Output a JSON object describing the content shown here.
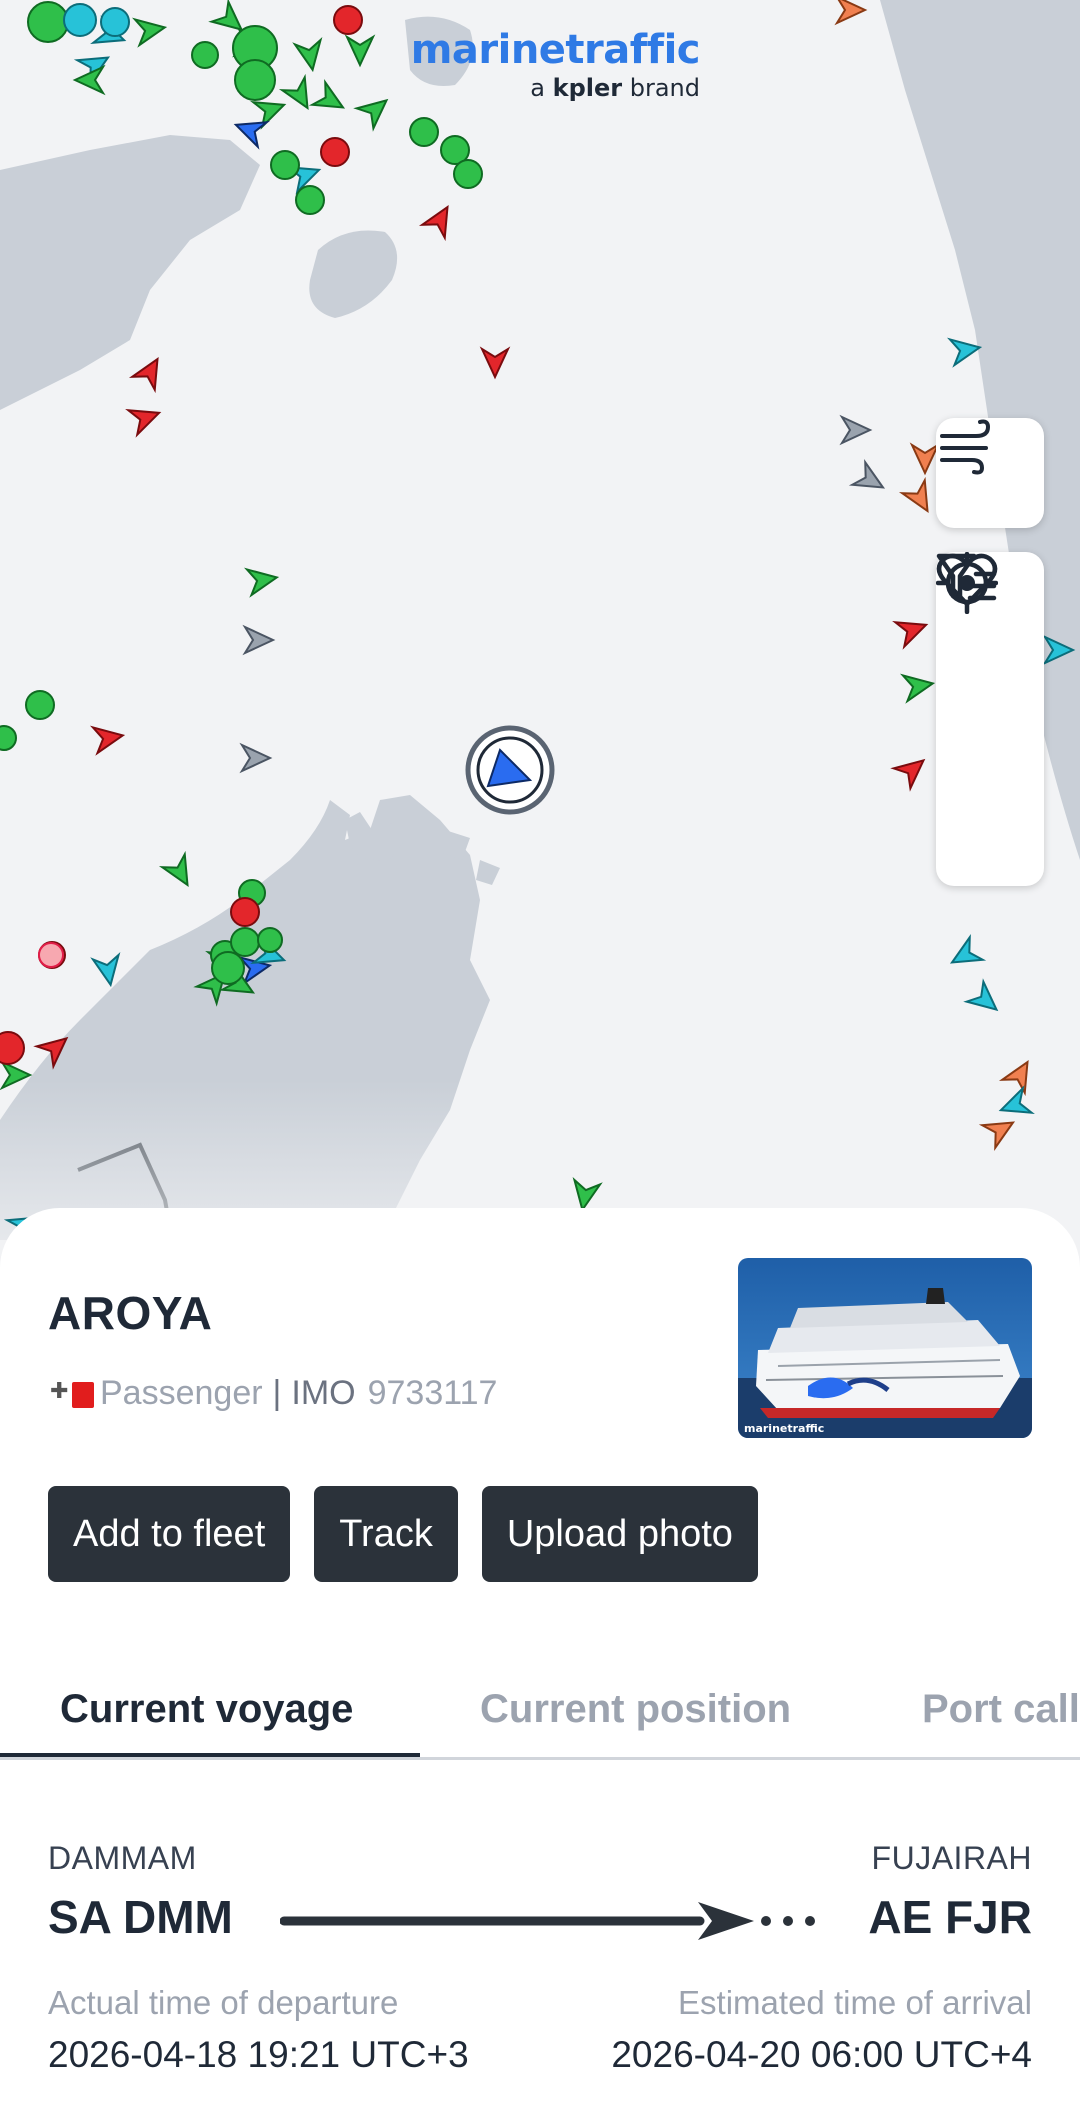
{
  "brand": {
    "name": "marinetraffic",
    "sub_prefix": "a",
    "sub_bold": "kpler",
    "sub_suffix": "brand"
  },
  "map_controls": {
    "wind_icon": "wind-icon",
    "favorite_icon": "heart-icon",
    "filter_icon": "filter-icon",
    "locate_icon": "crosshair-icon"
  },
  "vessel": {
    "name": "AROYA",
    "type": "Passenger",
    "separator": "|",
    "imo_label": "IMO",
    "imo": "9733117",
    "photo_watermark": "marinetraffic"
  },
  "actions": {
    "add_to_fleet": "Add to fleet",
    "track": "Track",
    "upload_photo": "Upload photo"
  },
  "tabs": [
    {
      "label": "Current voyage",
      "active": true
    },
    {
      "label": "Current position",
      "active": false
    },
    {
      "label": "Port calls",
      "active": false
    }
  ],
  "voyage": {
    "departure": {
      "city": "DAMMAM",
      "code": "SA DMM",
      "time_label": "Actual time of departure",
      "time": "2026-04-18 19:21 UTC+3"
    },
    "arrival": {
      "city": "FUJAIRAH",
      "code": "AE FJR",
      "time_label": "Estimated time of arrival",
      "time": "2026-04-20 06:00 UTC+4"
    }
  },
  "colors": {
    "cargo": "#2fbf4a",
    "tanker": "#e3262b",
    "passenger": "#2a6cf0",
    "tug": "#27c2d8",
    "fishing": "#f08050",
    "unknown": "#9aa3ae",
    "land": "#c8ced6",
    "water": "#f2f3f5",
    "button": "#2b323a"
  }
}
